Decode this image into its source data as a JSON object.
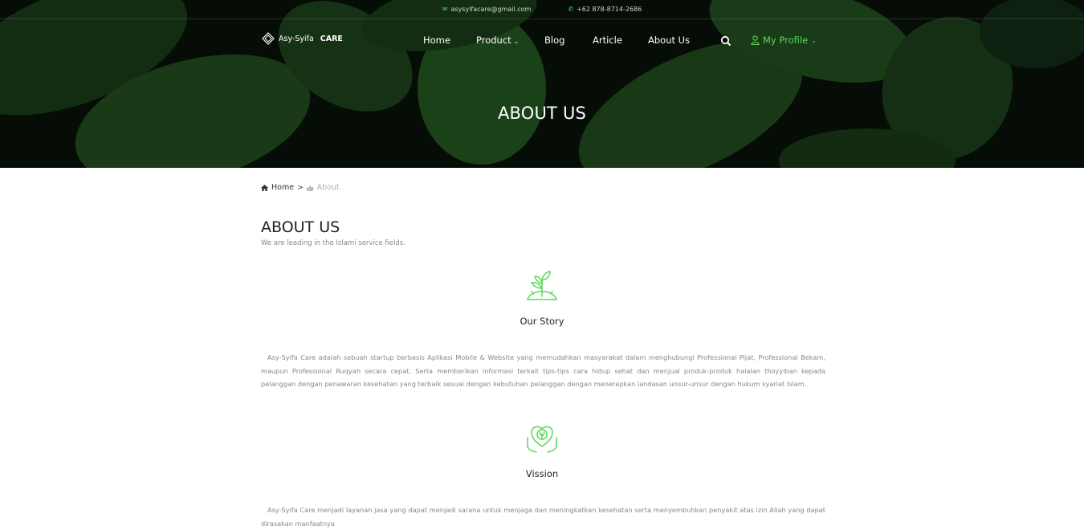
{
  "topbar": {
    "email": "asysyifacare@gmail.com",
    "phone": "+62 878-8714-2686",
    "email_icon": "envelope-icon",
    "phone_icon": "whatsapp-icon"
  },
  "brand": {
    "name": "Asy-Syifa",
    "suffix": "CARE"
  },
  "nav": {
    "items": [
      {
        "label": "Home"
      },
      {
        "label": "Product"
      },
      {
        "label": "Blog"
      },
      {
        "label": "Article"
      },
      {
        "label": "About Us"
      }
    ],
    "profile_label": "My Profile"
  },
  "hero": {
    "title": "ABOUT US"
  },
  "breadcrumb": {
    "home": "Home",
    "separator": ">",
    "current": "About"
  },
  "about": {
    "title": "ABOUT US",
    "subtitle": "We are leading in the Islami service fields."
  },
  "features": [
    {
      "title": "Our Story",
      "icon": "sprout-icon",
      "text": "Asy-Syifa Care adalah sebuah startup berbasis Aplikasi Mobile & Website yang memudahkan masyarakat dalam menghubungi Professional Pijat, Professional Bekam, maupun Professional Ruqyah secara cepat. Serta memberikan informasi terkait tips-tips cara hidup sehat dan menjual produk-produk halalan thoyyiban kepada pelanggan dengan penawaran kesehatan yang terbaik sesuai dengan kebutuhan pelanggan dengan menerapkan landasan unsur-unsur dengan hukum syariat Islam."
    },
    {
      "title": "Vission",
      "icon": "heart-hands-icon",
      "text": "Asy-Syifa Care menjadi layanan jasa yang dapat menjadi sarana untuk menjaga dan meningkatkan kesehatan serta menyembuhkan penyakit atas izin Allah yang dapat dirasakan manfaatnya"
    }
  ],
  "colors": {
    "accent": "#5cd65c",
    "hero_bg": "#0a1a0b"
  }
}
